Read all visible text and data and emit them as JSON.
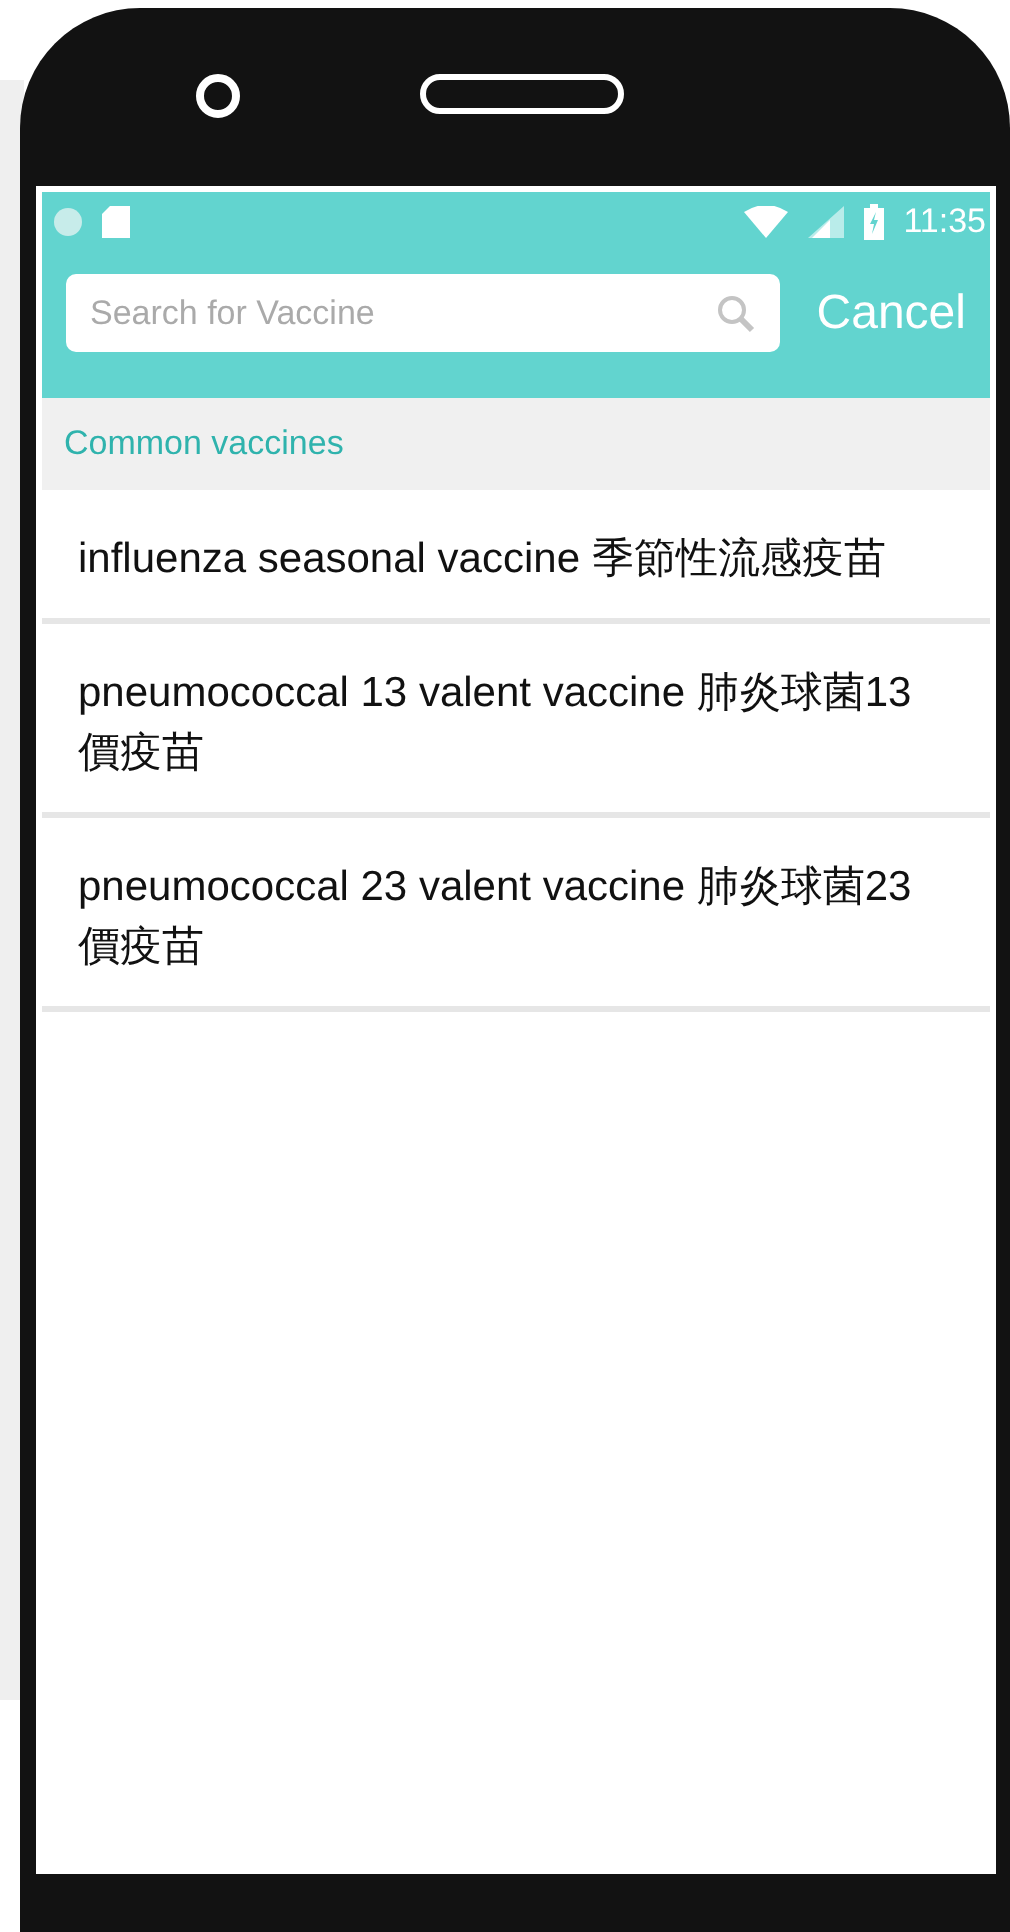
{
  "status_bar": {
    "time": "11:35"
  },
  "search": {
    "placeholder": "Search for Vaccine"
  },
  "cancel_button": "Cancel",
  "section_header": "Common vaccines",
  "vaccines": [
    {
      "label": "influenza seasonal vaccine 季節性流感疫苗"
    },
    {
      "label": "pneumococcal 13 valent vaccine 肺炎球菌13價疫苗"
    },
    {
      "label": "pneumococcal 23 valent vaccine 肺炎球菌23價疫苗"
    }
  ]
}
